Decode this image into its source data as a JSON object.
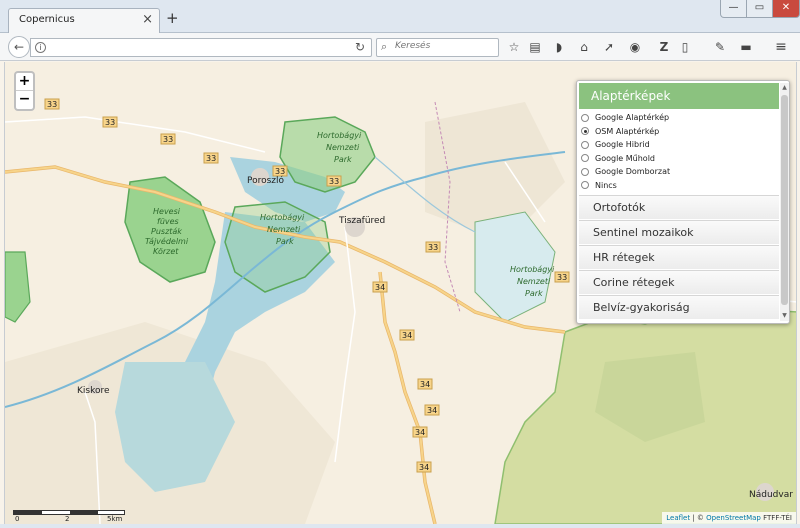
{
  "window": {
    "tab_title": "Copernicus",
    "close_glyph": "×",
    "new_tab_glyph": "+",
    "min_glyph": "—",
    "max_glyph": "▭",
    "close_win_glyph": "✕"
  },
  "navbar": {
    "url_value": "",
    "search_placeholder": "Keresés",
    "icons": [
      "bookmark-star-icon",
      "reading-list-icon",
      "pocket-icon",
      "home-icon",
      "pin-icon",
      "globe-icon",
      "zotero-icon",
      "page-icon",
      "eyedropper-icon",
      "folder-icon",
      "menu-icon"
    ]
  },
  "map": {
    "zoom_in": "+",
    "zoom_out": "−",
    "scale_labels": [
      "0",
      "2",
      "5km"
    ],
    "road_labels": [
      "33",
      "33",
      "33",
      "33",
      "33",
      "33",
      "33",
      "33",
      "34",
      "34",
      "34",
      "34",
      "34",
      "34"
    ],
    "places": [
      "Poroszló",
      "Tiszafüred",
      "Kiskore",
      "Nádudvar"
    ],
    "park_labels": {
      "p1": [
        "Hortobágyi",
        "Nemzeti",
        "Park"
      ],
      "p2": [
        "Hortobágyi",
        "Nemzeti",
        "Park"
      ],
      "p3": [
        "Hortobágyi",
        "Nemzeti",
        "Park"
      ],
      "p4": [
        "Hevesi",
        "füves",
        "Puszták",
        "Tájvédelmi",
        "Körzet"
      ]
    },
    "attribution": {
      "leaflet": "Leaflet",
      "sep": " | © ",
      "osm": "OpenStreetMap",
      "suffix": " FTFF-TÉI"
    }
  },
  "layer_panel": {
    "header": "Alaptérképek",
    "base_layers": [
      {
        "label": "Google Alaptérkép",
        "selected": false
      },
      {
        "label": "OSM Alaptérkép",
        "selected": true
      },
      {
        "label": "Google Hibrid",
        "selected": false
      },
      {
        "label": "Google Műhold",
        "selected": false
      },
      {
        "label": "Google Domborzat",
        "selected": false
      },
      {
        "label": "Nincs",
        "selected": false
      }
    ],
    "sections": [
      "Ortofotók",
      "Sentinel mozaikok",
      "HR rétegek",
      "Corine rétegek",
      "Belvíz-gyakoriság"
    ]
  },
  "colors": {
    "panel_header": "#8bc27f",
    "water": "#aad3df",
    "park": "#8fcf86",
    "forest": "#d4dda2",
    "road": "#f7d48a"
  }
}
